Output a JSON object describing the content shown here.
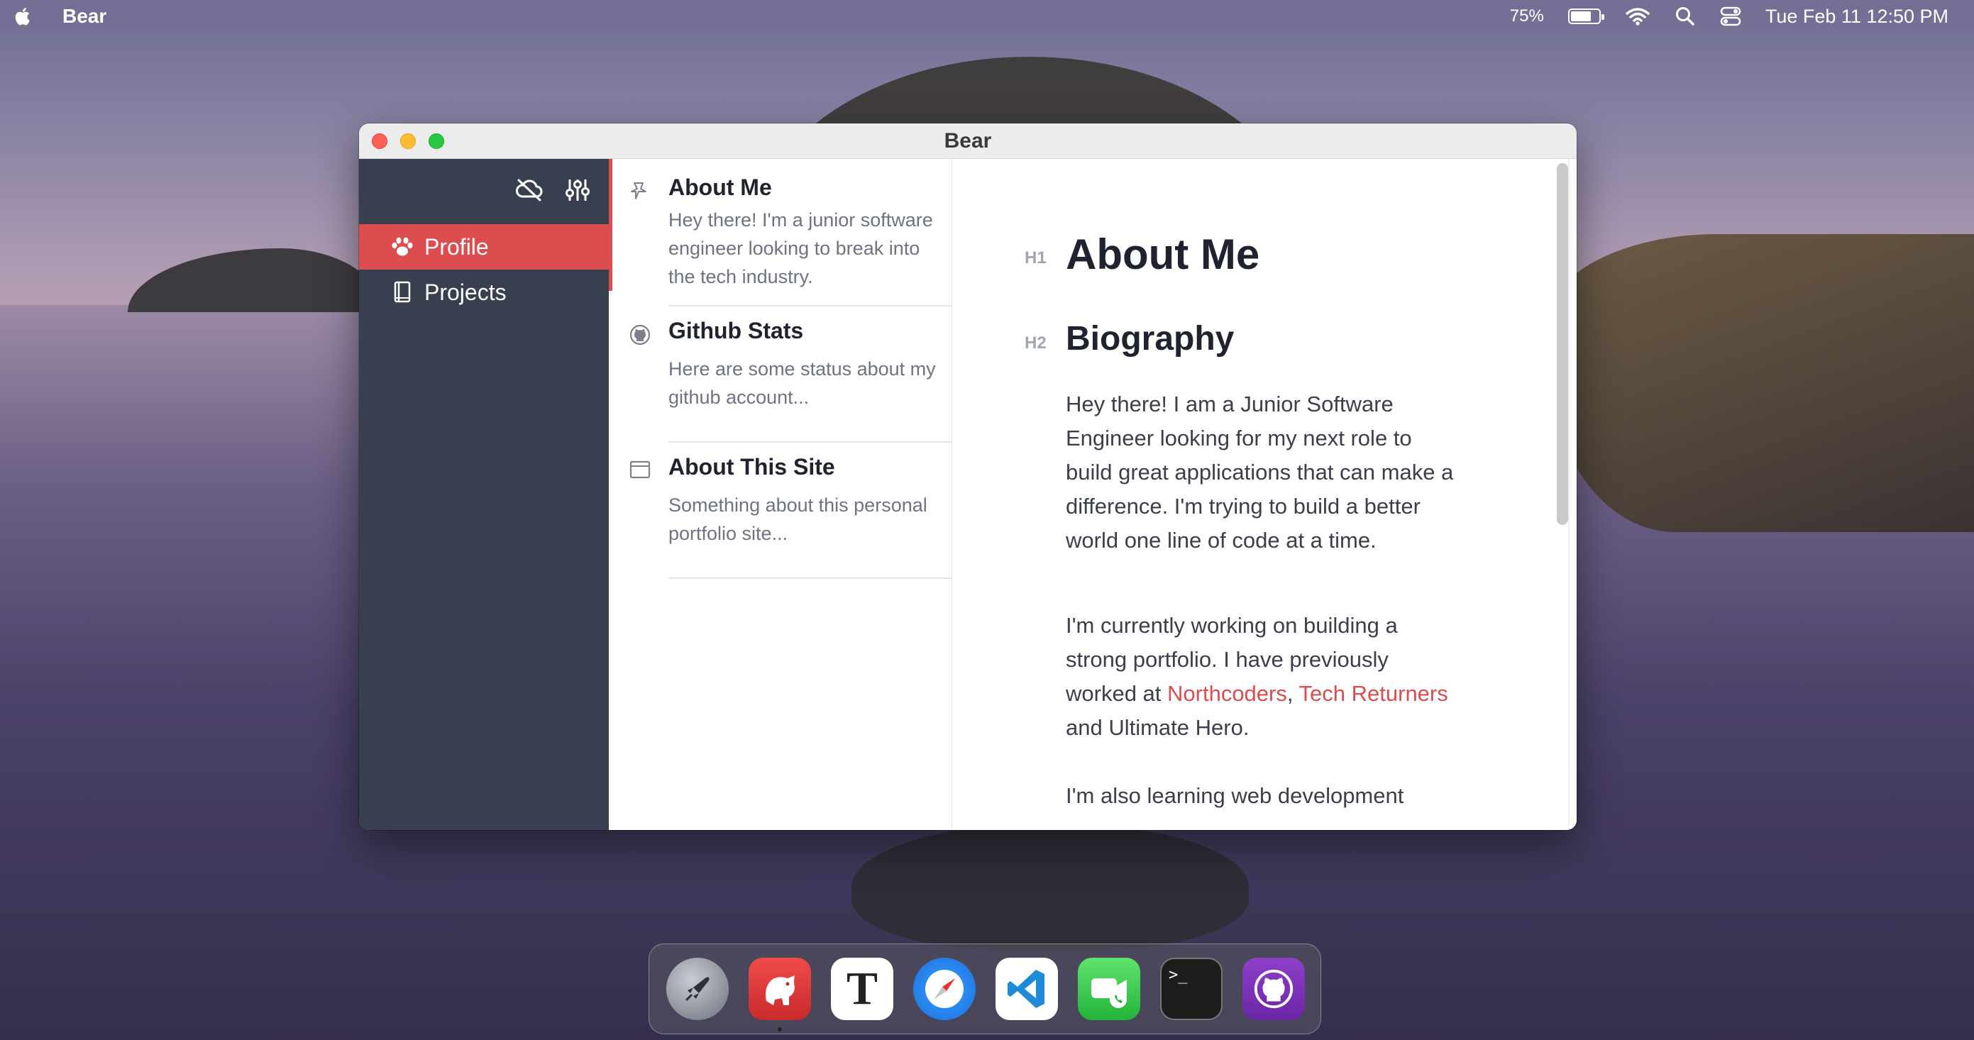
{
  "menubar": {
    "app_name": "Bear",
    "battery_percent": "75%",
    "battery_level": 0.75,
    "datetime": "Tue Feb 11  12:50 PM"
  },
  "window": {
    "title": "Bear"
  },
  "sidebar": {
    "items": [
      {
        "label": "Profile",
        "icon": "paw-icon",
        "active": true
      },
      {
        "label": "Projects",
        "icon": "book-icon",
        "active": false
      }
    ]
  },
  "notes": [
    {
      "title": "About Me",
      "snippet": "Hey there! I'm a junior software engineer looking to break into the tech industry.",
      "icon": "pin-icon",
      "selected": true
    },
    {
      "title": "Github Stats",
      "snippet": "Here are some status about my github account...",
      "icon": "github-icon",
      "selected": false
    },
    {
      "title": "About This Site",
      "snippet": "Something about this personal portfolio site...",
      "icon": "browser-window-icon",
      "selected": false
    }
  ],
  "editor": {
    "h1_marker": "H1",
    "h1": "About Me",
    "h2_marker": "H2",
    "h2": "Biography",
    "para1": "Hey there! I am a Junior Software Engineer looking for my next role to build great applications that can make a difference. I'm trying to build a better world one line of code at a time.",
    "para2_before": "I'm currently working on building a strong portfolio. I have previously worked at ",
    "para2_link1": "Northcoders",
    "para2_comma": ", ",
    "para2_link2": "Tech Returners",
    "para2_after": " and Ultimate Hero.",
    "para3": "I'm also learning web development"
  },
  "dock": {
    "apps": [
      "Launchpad",
      "Bear",
      "Typora",
      "Safari",
      "Visual Studio Code",
      "FaceTime",
      "Terminal",
      "GitHub Desktop"
    ],
    "terminal_prompt": ">_"
  },
  "colors": {
    "accent": "#dd4c4f",
    "sidebar_bg": "#383f4e"
  }
}
